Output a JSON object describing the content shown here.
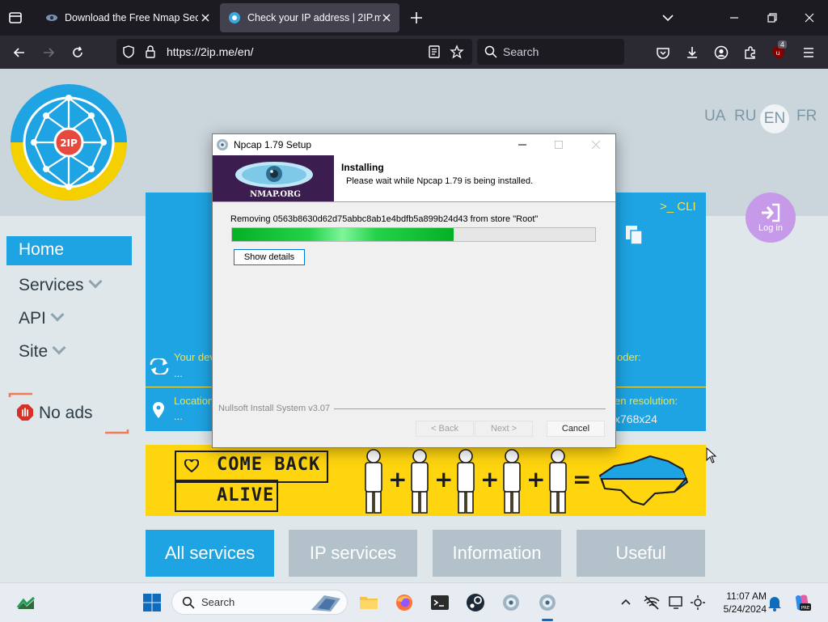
{
  "browser": {
    "tabs": [
      {
        "title": "Download the Free Nmap Security Scanner",
        "active": false
      },
      {
        "title": "Check your IP address | 2IP.me",
        "active": true
      }
    ],
    "url": "https://2ip.me/en/",
    "search_placeholder": "Search",
    "extension_badge": "4"
  },
  "site": {
    "logo_text": "2IP",
    "languages": [
      "UA",
      "RU",
      "EN",
      "FR"
    ],
    "active_language": "EN",
    "login_label": "Log in",
    "sidebar": [
      {
        "label": "Home"
      },
      {
        "label": "Services"
      },
      {
        "label": "API"
      },
      {
        "label": "Site"
      }
    ],
    "noads_label": "No ads",
    "hero": {
      "cli": ">_ CLI",
      "device_label": "Your dev",
      "device_value": "...",
      "location_label": "Location",
      "location_value": "...",
      "browser_label_suffix": "oder:",
      "screen_label": "en resolution:",
      "screen_value": "x768x24"
    },
    "banner": {
      "line1": "COME BACK",
      "line2": "ALIVE"
    },
    "services_tabs": [
      "All services",
      "IP services",
      "Information",
      "Useful"
    ]
  },
  "dialog": {
    "title": "Npcap 1.79 Setup",
    "header_title": "Installing",
    "header_subtitle": "Please wait while Npcap 1.79 is being installed.",
    "image_text": "NMAP.ORG",
    "status_text": "Removing 0563b8630d62d75abbc8ab1e4bdfb5a899b24d43 from store \"Root\"",
    "progress_percent": 61,
    "show_details_label": "Show details",
    "footer_text": "Nullsoft Install System v3.07",
    "back_label": "< Back",
    "next_label": "Next >",
    "cancel_label": "Cancel"
  },
  "taskbar": {
    "search_placeholder": "Search",
    "time": "11:07 AM",
    "date": "5/24/2024"
  },
  "colors": {
    "accent_blue": "#1ea4e2",
    "banner_yellow": "#ffd50f",
    "progress_green": "#06b025"
  }
}
